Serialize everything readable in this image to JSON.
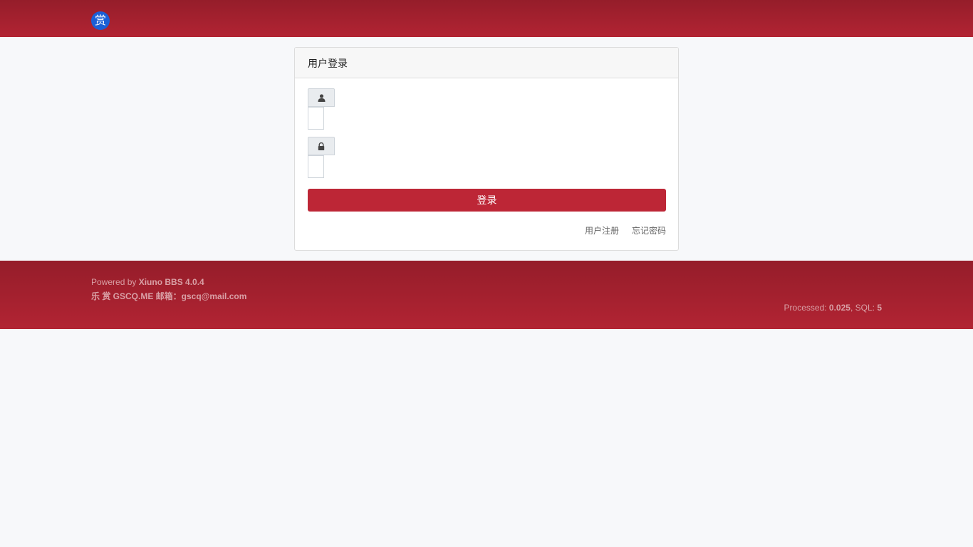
{
  "header": {
    "logo_text": "赏"
  },
  "login_card": {
    "title": "用户登录",
    "username_icon": "user-icon",
    "password_icon": "lock-icon",
    "username_value": "",
    "password_value": "",
    "submit_label": "登录",
    "register_link": "用户注册",
    "forgot_link": "忘记密码"
  },
  "footer": {
    "powered_prefix": "Powered by ",
    "powered_name": "Xiuno BBS 4.0.4",
    "site_line": "乐 赏 GSCQ.ME 邮箱：gscq@mail.com",
    "processed_label": "Processed: ",
    "processed_value": "0.025",
    "sql_label": ", SQL: ",
    "sql_value": "5"
  },
  "colors": {
    "brand_red": "#bd2636",
    "header_gradient_top": "#951d2a",
    "header_gradient_bottom": "#b22433",
    "logo_blue": "#1a5fd6"
  }
}
